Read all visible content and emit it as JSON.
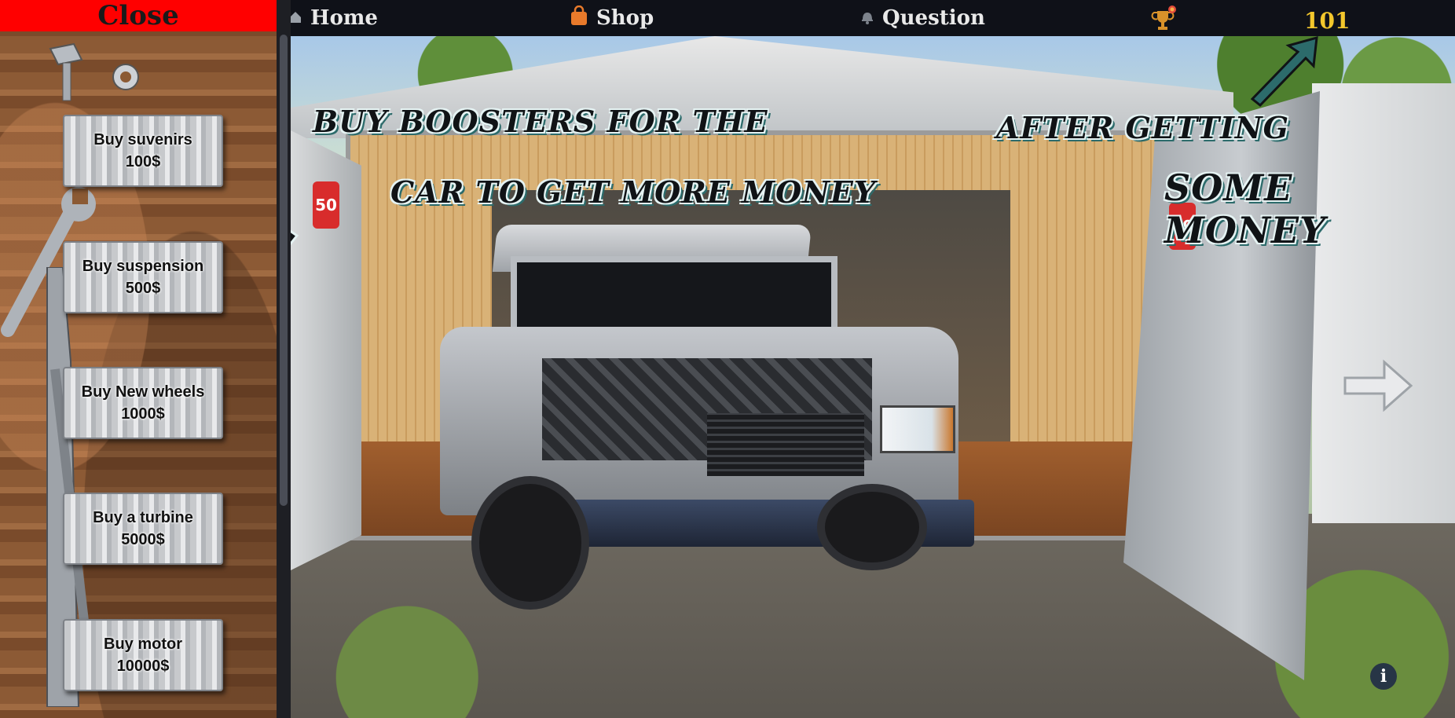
{
  "nav": {
    "home": "Home",
    "shop": "Shop",
    "question": "Question",
    "score": "101"
  },
  "sidebar": {
    "close": "Close",
    "items": [
      {
        "label": "Buy suvenirs",
        "price": "100$"
      },
      {
        "label": "Buy suspension",
        "price": "500$"
      },
      {
        "label": "Buy New wheels",
        "price": "1000$"
      },
      {
        "label": "Buy a turbine",
        "price": "5000$"
      },
      {
        "label": "Buy motor",
        "price": "10000$"
      }
    ]
  },
  "tutorial": {
    "line1": "Buy boosters for the",
    "line2": "car to get more money",
    "line3": "after getting",
    "line4": "some money"
  },
  "scene": {
    "sign_text": "50",
    "info": "i"
  },
  "colors": {
    "close_bg": "#ff0000",
    "score": "#f3c72c",
    "nav_bg": "#0f1118",
    "arrow": "#2c6b6b"
  }
}
